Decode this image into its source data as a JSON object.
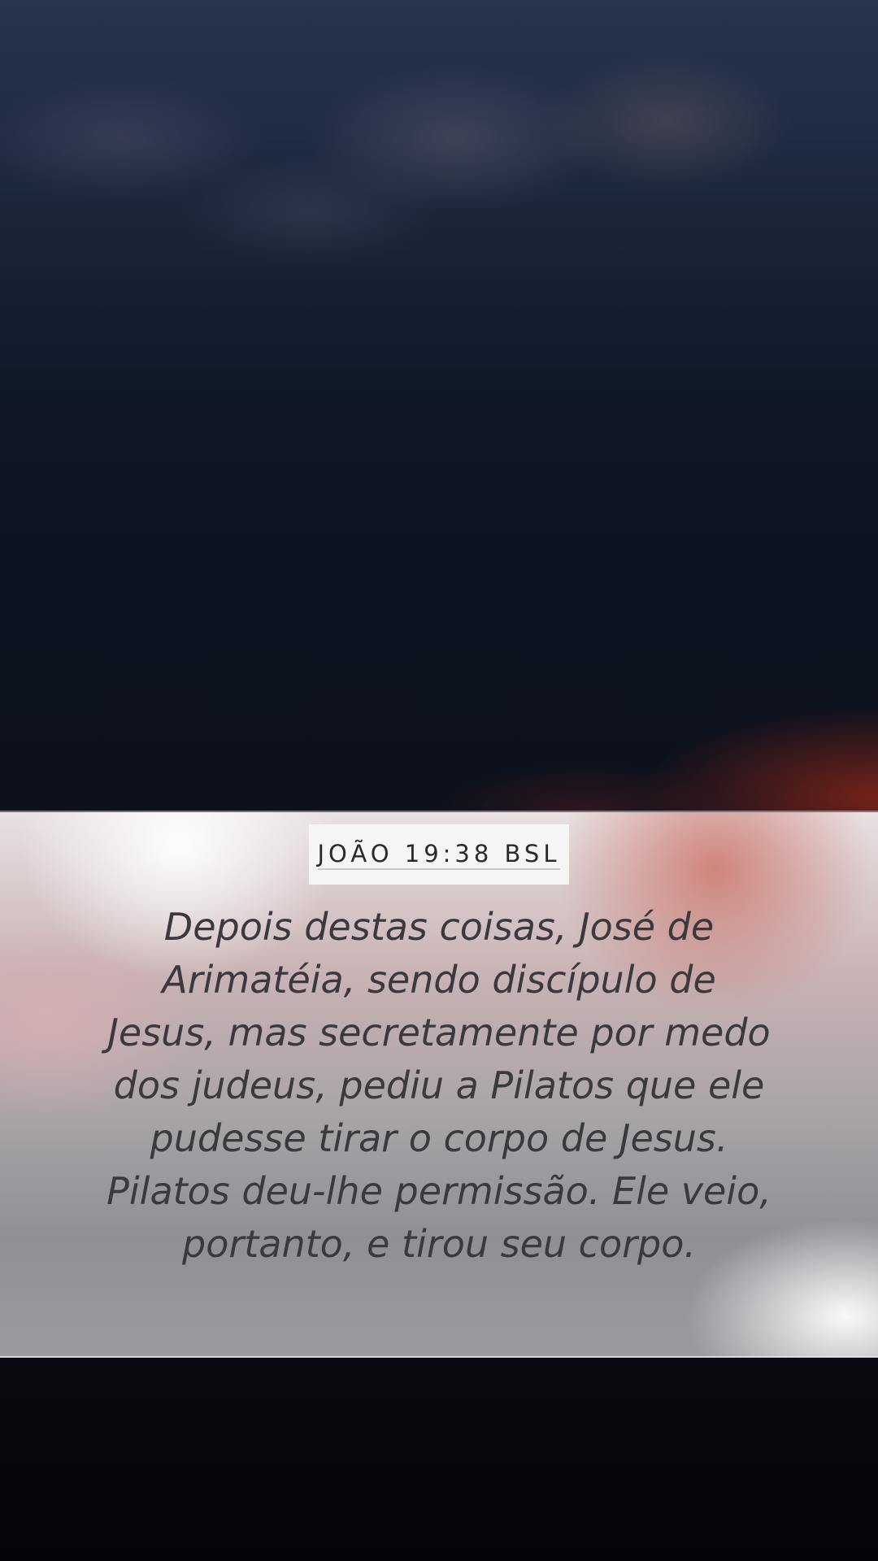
{
  "verse": {
    "reference": "JOÃO 19:38 BSL",
    "lines": [
      "Depois destas coisas, José de",
      "Arimatéia, sendo discípulo de",
      "Jesus, mas secretamente por medo",
      "dos judeus, pediu a Pilatos que ele",
      "pudesse tirar o corpo de Jesus.",
      "Pilatos deu-lhe permissão. Ele veio,",
      "portanto, e tirou seu corpo."
    ]
  },
  "colors": {
    "sky_top": "#26344d",
    "sky_bottom": "#0d111c",
    "sunset_glow": "#96281a",
    "verse_text": "#3a3a3e",
    "reference_box": "#f8f7f7",
    "bottom_dark": "#06060c"
  }
}
